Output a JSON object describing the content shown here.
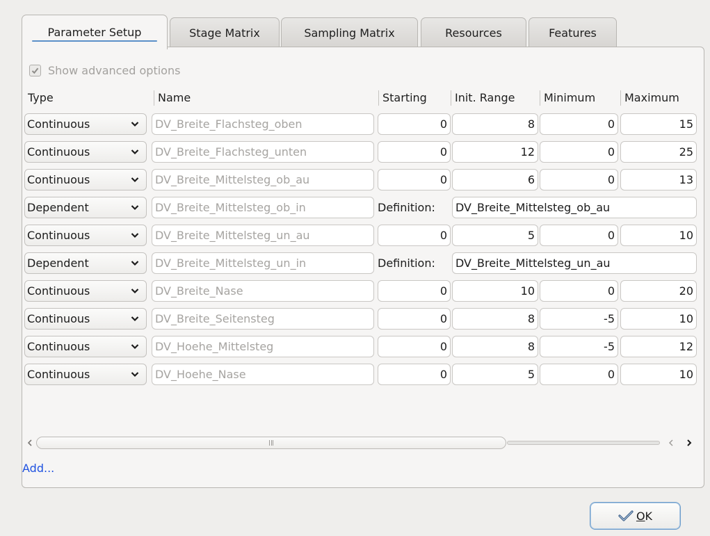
{
  "tabs": [
    {
      "label": "Parameter Setup",
      "active": true
    },
    {
      "label": "Stage Matrix",
      "active": false
    },
    {
      "label": "Sampling Matrix",
      "active": false
    },
    {
      "label": "Resources",
      "active": false
    },
    {
      "label": "Features",
      "active": false
    }
  ],
  "advanced": {
    "label": "Show advanced options",
    "checked": true
  },
  "columns": {
    "type": "Type",
    "name": "Name",
    "starting": "Starting",
    "init_range": "Init. Range",
    "minimum": "Minimum",
    "maximum": "Maximum"
  },
  "rows": [
    {
      "type": "Continuous",
      "name": "DV_Breite_Flachsteg_oben",
      "starting": "0",
      "init_range": "8",
      "minimum": "0",
      "maximum": "15"
    },
    {
      "type": "Continuous",
      "name": "DV_Breite_Flachsteg_unten",
      "starting": "0",
      "init_range": "12",
      "minimum": "0",
      "maximum": "25"
    },
    {
      "type": "Continuous",
      "name": "DV_Breite_Mittelsteg_ob_au",
      "starting": "0",
      "init_range": "6",
      "minimum": "0",
      "maximum": "13"
    },
    {
      "type": "Dependent",
      "name": "DV_Breite_Mittelsteg_ob_in",
      "definition_label": "Definition:",
      "definition": "DV_Breite_Mittelsteg_ob_au"
    },
    {
      "type": "Continuous",
      "name": "DV_Breite_Mittelsteg_un_au",
      "starting": "0",
      "init_range": "5",
      "minimum": "0",
      "maximum": "10"
    },
    {
      "type": "Dependent",
      "name": "DV_Breite_Mittelsteg_un_in",
      "definition_label": "Definition:",
      "definition": "DV_Breite_Mittelsteg_un_au"
    },
    {
      "type": "Continuous",
      "name": "DV_Breite_Nase",
      "starting": "0",
      "init_range": "10",
      "minimum": "0",
      "maximum": "20"
    },
    {
      "type": "Continuous",
      "name": "DV_Breite_Seitensteg",
      "starting": "0",
      "init_range": "8",
      "minimum": "-5",
      "maximum": "10"
    },
    {
      "type": "Continuous",
      "name": "DV_Hoehe_Mittelsteg",
      "starting": "0",
      "init_range": "8",
      "minimum": "-5",
      "maximum": "12"
    },
    {
      "type": "Continuous",
      "name": "DV_Hoehe_Nase",
      "starting": "0",
      "init_range": "5",
      "minimum": "0",
      "maximum": "10"
    }
  ],
  "add_link": "Add...",
  "ok_button": {
    "label": "OK",
    "mnemonic": "O",
    "rest": "K",
    "icon": "checkmark-icon"
  },
  "colors": {
    "link": "#1f52e0",
    "focus": "#5a8fc8",
    "background": "#efeeec"
  }
}
